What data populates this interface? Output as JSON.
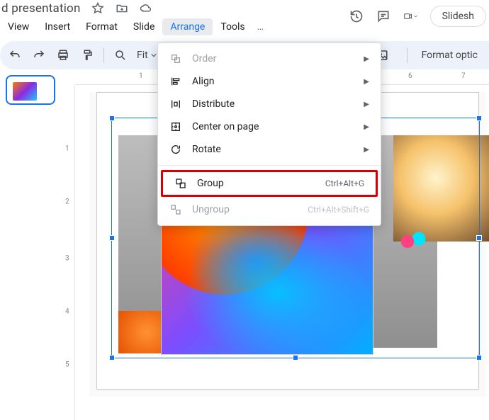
{
  "titlebar": {
    "doc_title": "d presentation"
  },
  "menubar": {
    "items": [
      "View",
      "Insert",
      "Format",
      "Slide",
      "Arrange",
      "Tools"
    ],
    "more": "…"
  },
  "toolbar": {
    "zoom_label": "Fit",
    "format_options": "Format optic"
  },
  "topright": {
    "slideshow": "Slidesh"
  },
  "ruler_h": {
    "n1": "1",
    "n6": "6",
    "n7": "7"
  },
  "ruler_v": {
    "n1": "1",
    "n2": "2",
    "n3": "3",
    "n4": "4",
    "n5": "5"
  },
  "context_menu": {
    "order": {
      "label": "Order"
    },
    "align": {
      "label": "Align"
    },
    "distribute": {
      "label": "Distribute"
    },
    "center": {
      "label": "Center on page"
    },
    "rotate": {
      "label": "Rotate"
    },
    "group": {
      "label": "Group",
      "shortcut": "Ctrl+Alt+G"
    },
    "ungroup": {
      "label": "Ungroup",
      "shortcut": "Ctrl+Alt+Shift+G"
    }
  }
}
